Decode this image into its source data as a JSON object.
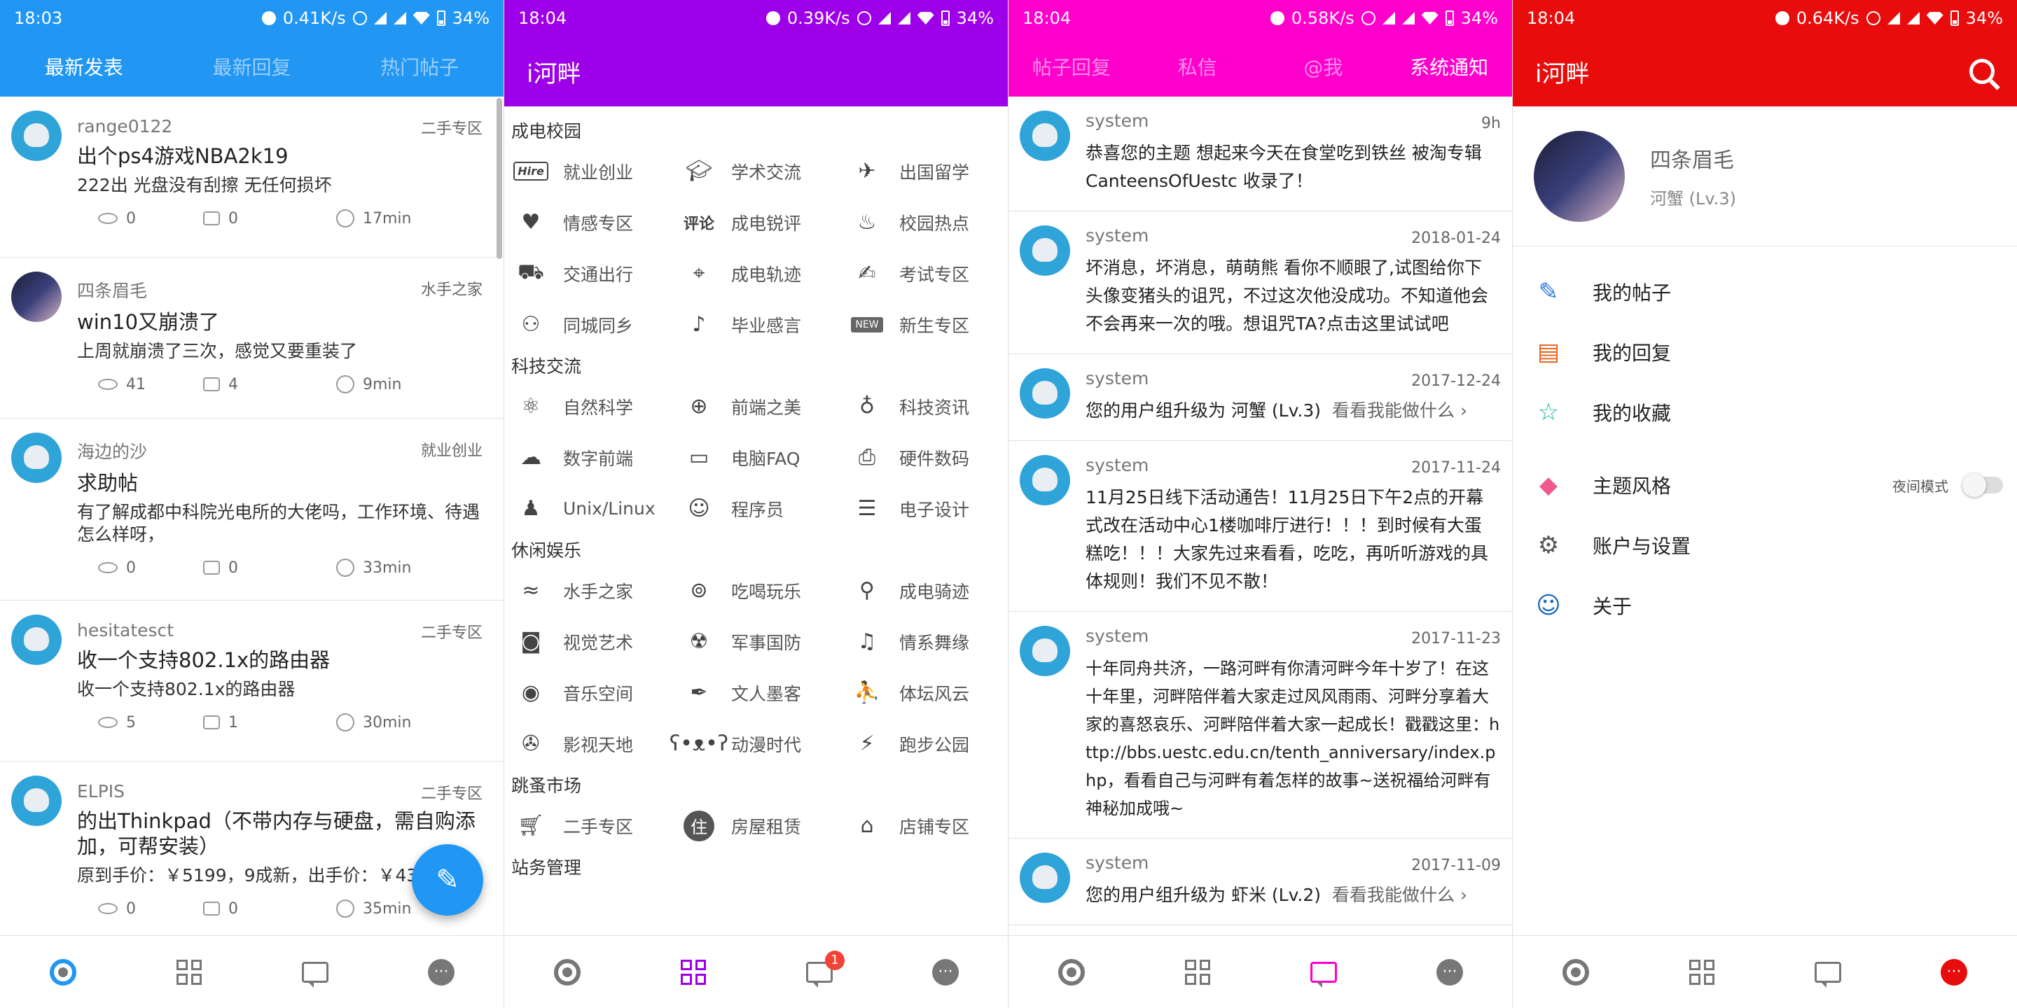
{
  "panel1": {
    "status": {
      "time": "18:03",
      "speed": "0.41K/s",
      "battery": "34%"
    },
    "tabs": [
      "最新发表",
      "最新回复",
      "热门帖子"
    ],
    "posts": [
      {
        "user": "range0122",
        "board": "二手专区",
        "title": "出个ps4游戏NBA2k19",
        "body": "222出  光盘没有刮擦 无任何损坏",
        "views": "0",
        "replies": "0",
        "time": "17min"
      },
      {
        "user": "四条眉毛",
        "board": "水手之家",
        "title": "win10又崩溃了",
        "body": "上周就崩溃了三次，感觉又要重装了",
        "views": "41",
        "replies": "4",
        "time": "9min"
      },
      {
        "user": "海边的沙",
        "board": "就业创业",
        "title": "求助帖",
        "body": "有了解成都中科院光电所的大佬吗，工作环境、待遇怎么样呀，",
        "views": "0",
        "replies": "0",
        "time": "33min"
      },
      {
        "user": "hesitatesct",
        "board": "二手专区",
        "title": "收一个支持802.1x的路由器",
        "body": "收一个支持802.1x的路由器",
        "views": "5",
        "replies": "1",
        "time": "30min"
      },
      {
        "user": "ELPIS",
        "board": "二手专区",
        "title": "的出Thinkpad（不带内存与硬盘，需自购添加，可帮安装）",
        "body": "原到手价：￥5199，9成新，出手价：￥432",
        "views": "0",
        "replies": "0",
        "time": "35min"
      }
    ]
  },
  "panel2": {
    "status": {
      "time": "18:04",
      "speed": "0.39K/s",
      "battery": "34%"
    },
    "app_title": "i河畔",
    "badge": "1",
    "sections": [
      {
        "title": "成电校园",
        "items": [
          "就业创业",
          "学术交流",
          "出国留学",
          "情感专区",
          "成电锐评",
          "校园热点",
          "交通出行",
          "成电轨迹",
          "考试专区",
          "同城同乡",
          "毕业感言",
          "新生专区"
        ]
      },
      {
        "title": "科技交流",
        "items": [
          "自然科学",
          "前端之美",
          "科技资讯",
          "数字前端",
          "电脑FAQ",
          "硬件数码",
          "Unix/Linux",
          "程序员",
          "电子设计"
        ]
      },
      {
        "title": "休闲娱乐",
        "items": [
          "水手之家",
          "吃喝玩乐",
          "成电骑迹",
          "视觉艺术",
          "军事国防",
          "情系舞缘",
          "音乐空间",
          "文人墨客",
          "体坛风云",
          "影视天地",
          "动漫时代",
          "跑步公园"
        ]
      },
      {
        "title": "跳蚤市场",
        "items": [
          "二手专区",
          "房屋租赁",
          "店铺专区"
        ]
      },
      {
        "title": "站务管理",
        "items": []
      }
    ],
    "icon_labels": {
      "hire": "Hire",
      "review": "评论",
      "new": "NEW",
      "rent": "住"
    }
  },
  "panel3": {
    "status": {
      "time": "18:04",
      "speed": "0.58K/s",
      "battery": "34%"
    },
    "tabs": [
      "帖子回复",
      "私信",
      "@我",
      "系统通知"
    ],
    "notes": [
      {
        "sender": "system",
        "date": "9h",
        "text": "恭喜您的主题 想起来今天在食堂吃到铁丝 被淘专辑CanteensOfUestc 收录了！"
      },
      {
        "sender": "system",
        "date": "2018-01-24",
        "text": "坏消息，坏消息，萌萌熊 看你不顺眼了,试图给你下头像变猪头的诅咒，不过这次他没成功。不知道他会不会再来一次的哦。想诅咒TA?点击这里试试吧"
      },
      {
        "sender": "system",
        "date": "2017-12-24",
        "text": "您的用户组升级为 河蟹 (Lv.3)",
        "more": "看看我能做什么 ›"
      },
      {
        "sender": "system",
        "date": "2017-11-24",
        "text": "11月25日线下活动通告！11月25日下午2点的开幕式改在活动中心1楼咖啡厅进行！！！到时候有大蛋糕吃！！！大家先过来看看，吃吃，再听听游戏的具体规则！我们不见不散！"
      },
      {
        "sender": "system",
        "date": "2017-11-23",
        "text": "十年同舟共济，一路河畔有你清河畔今年十岁了！在这十年里，河畔陪伴着大家走过风风雨雨、河畔分享着大家的喜怒哀乐、河畔陪伴着大家一起成长！戳戳这里：http://bbs.uestc.edu.cn/tenth_anniversary/index.php，看看自己与河畔有着怎样的故事~送祝福给河畔有神秘加成哦~"
      },
      {
        "sender": "system",
        "date": "2017-11-09",
        "text": "您的用户组升级为 虾米 (Lv.2)",
        "more": "看看我能做什么 ›"
      }
    ]
  },
  "panel4": {
    "status": {
      "time": "18:04",
      "speed": "0.64K/s",
      "battery": "34%"
    },
    "app_title": "i河畔",
    "profile": {
      "name": "四条眉毛",
      "level": "河蟹 (Lv.3)"
    },
    "menu": [
      "我的帖子",
      "我的回复",
      "我的收藏",
      "主题风格",
      "账户与设置",
      "关于"
    ],
    "night_mode_label": "夜间模式"
  },
  "colors": {
    "blue": "#2196f3",
    "purple": "#9d00e8",
    "magenta": "#ff00cc",
    "red": "#e80c0c"
  }
}
